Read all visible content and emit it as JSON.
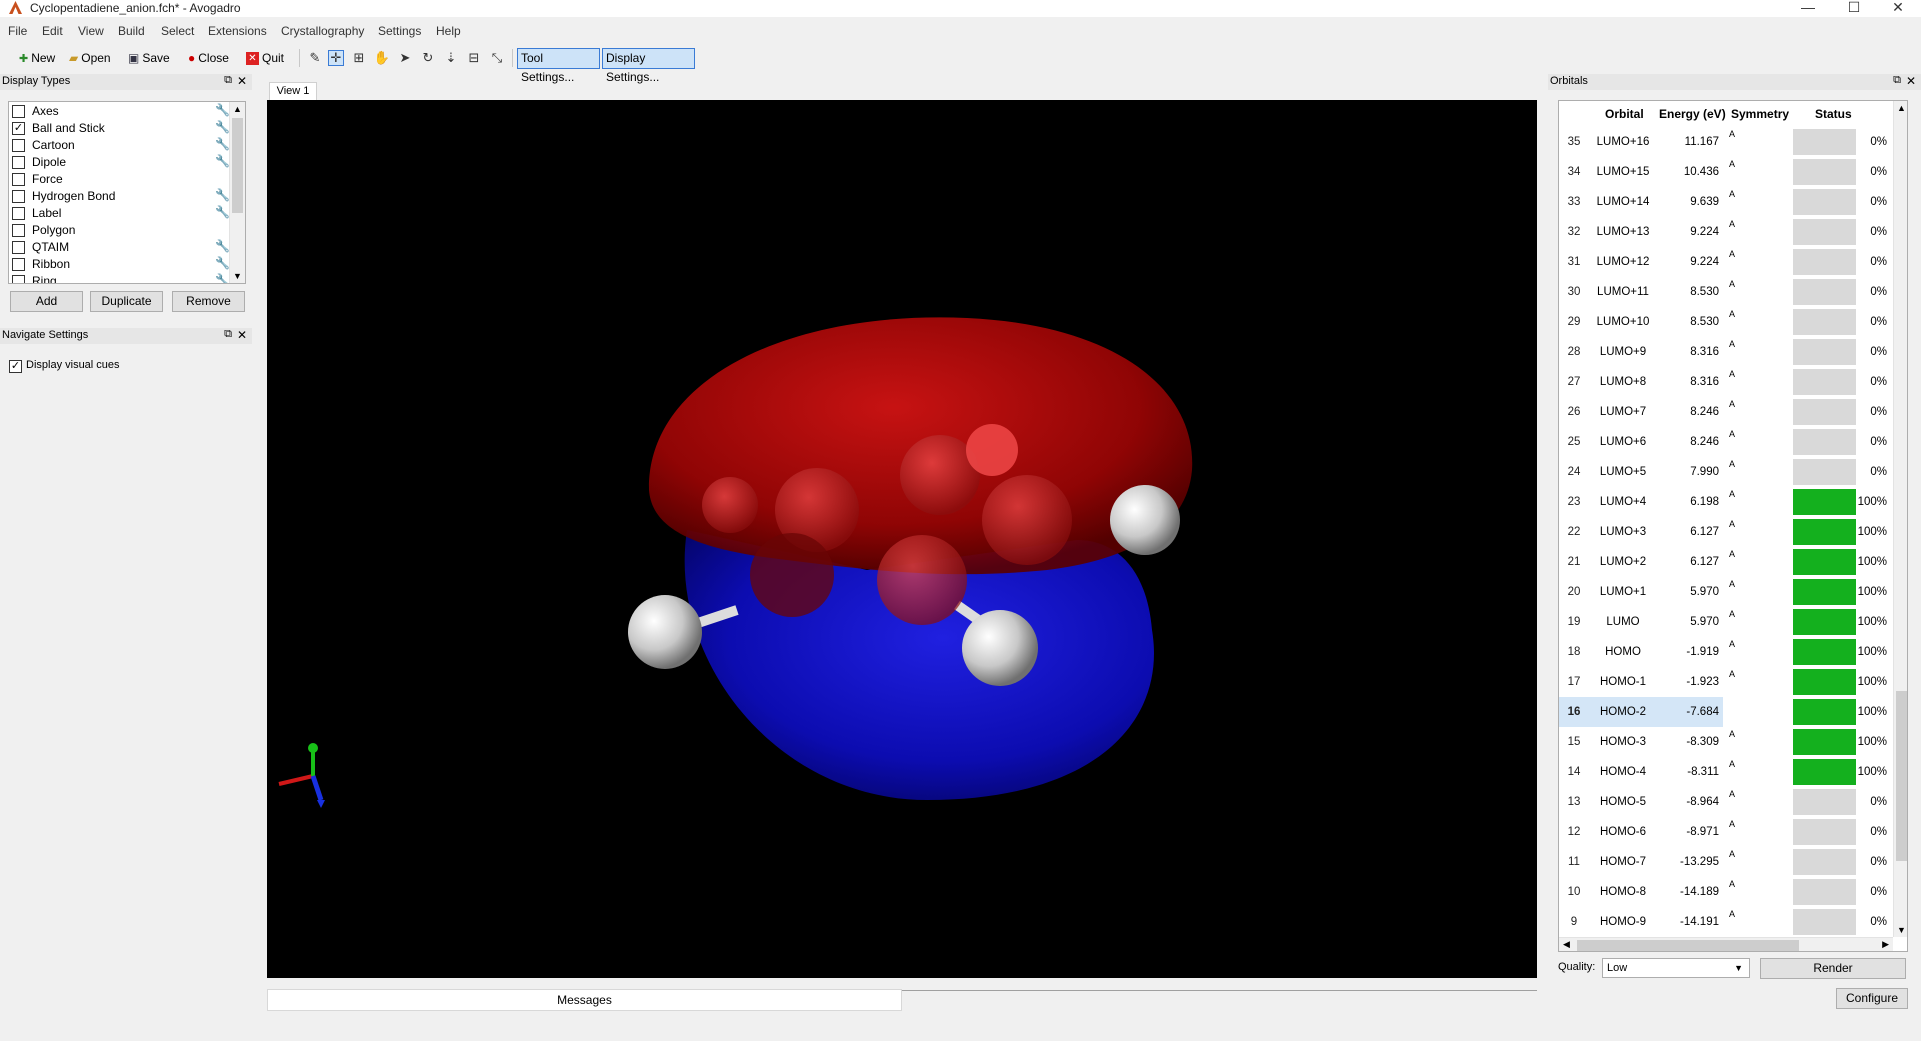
{
  "window": {
    "title": "Cyclopentadiene_anion.fch* - Avogadro",
    "controls": {
      "minimize": "—",
      "maximize": "☐",
      "close": "✕"
    }
  },
  "menubar": [
    "File",
    "Edit",
    "View",
    "Build",
    "Select",
    "Extensions",
    "Crystallography",
    "Settings",
    "Help"
  ],
  "toolbar": {
    "new": "New",
    "open": "Open",
    "save": "Save",
    "close": "Close",
    "quit": "Quit",
    "tool_settings": "Tool Settings...",
    "display_settings": "Display Settings..."
  },
  "display_types": {
    "title": "Display Types",
    "items": [
      {
        "label": "Axes",
        "checked": false,
        "settings": true
      },
      {
        "label": "Ball and Stick",
        "checked": true,
        "settings": true
      },
      {
        "label": "Cartoon",
        "checked": false,
        "settings": true
      },
      {
        "label": "Dipole",
        "checked": false,
        "settings": true
      },
      {
        "label": "Force",
        "checked": false,
        "settings": false
      },
      {
        "label": "Hydrogen Bond",
        "checked": false,
        "settings": true
      },
      {
        "label": "Label",
        "checked": false,
        "settings": true
      },
      {
        "label": "Polygon",
        "checked": false,
        "settings": false
      },
      {
        "label": "QTAIM",
        "checked": false,
        "settings": true
      },
      {
        "label": "Ribbon",
        "checked": false,
        "settings": true
      },
      {
        "label": "Ring",
        "checked": false,
        "settings": true
      }
    ],
    "add": "Add",
    "duplicate": "Duplicate",
    "remove": "Remove"
  },
  "navigate": {
    "title": "Navigate Settings",
    "visual_cues_label": "Display visual cues",
    "visual_cues_checked": true
  },
  "view": {
    "tab": "View 1"
  },
  "messages": {
    "tab": "Messages"
  },
  "orbitals": {
    "title": "Orbitals",
    "headers": {
      "orbital": "Orbital",
      "energy": "Energy (eV)",
      "symmetry": "Symmetry",
      "status": "Status"
    },
    "selected_index": "16",
    "rows": [
      {
        "idx": "35",
        "name": "LUMO+16",
        "energy": "11.167",
        "sym": "A",
        "status": 0,
        "pct": "0%"
      },
      {
        "idx": "34",
        "name": "LUMO+15",
        "energy": "10.436",
        "sym": "A",
        "status": 0,
        "pct": "0%"
      },
      {
        "idx": "33",
        "name": "LUMO+14",
        "energy": "9.639",
        "sym": "A",
        "status": 0,
        "pct": "0%"
      },
      {
        "idx": "32",
        "name": "LUMO+13",
        "energy": "9.224",
        "sym": "A",
        "status": 0,
        "pct": "0%"
      },
      {
        "idx": "31",
        "name": "LUMO+12",
        "energy": "9.224",
        "sym": "A",
        "status": 0,
        "pct": "0%"
      },
      {
        "idx": "30",
        "name": "LUMO+11",
        "energy": "8.530",
        "sym": "A",
        "status": 0,
        "pct": "0%"
      },
      {
        "idx": "29",
        "name": "LUMO+10",
        "energy": "8.530",
        "sym": "A",
        "status": 0,
        "pct": "0%"
      },
      {
        "idx": "28",
        "name": "LUMO+9",
        "energy": "8.316",
        "sym": "A",
        "status": 0,
        "pct": "0%"
      },
      {
        "idx": "27",
        "name": "LUMO+8",
        "energy": "8.316",
        "sym": "A",
        "status": 0,
        "pct": "0%"
      },
      {
        "idx": "26",
        "name": "LUMO+7",
        "energy": "8.246",
        "sym": "A",
        "status": 0,
        "pct": "0%"
      },
      {
        "idx": "25",
        "name": "LUMO+6",
        "energy": "8.246",
        "sym": "A",
        "status": 0,
        "pct": "0%"
      },
      {
        "idx": "24",
        "name": "LUMO+5",
        "energy": "7.990",
        "sym": "A",
        "status": 0,
        "pct": "0%"
      },
      {
        "idx": "23",
        "name": "LUMO+4",
        "energy": "6.198",
        "sym": "A",
        "status": 1,
        "pct": "100%"
      },
      {
        "idx": "22",
        "name": "LUMO+3",
        "energy": "6.127",
        "sym": "A",
        "status": 1,
        "pct": "100%"
      },
      {
        "idx": "21",
        "name": "LUMO+2",
        "energy": "6.127",
        "sym": "A",
        "status": 1,
        "pct": "100%"
      },
      {
        "idx": "20",
        "name": "LUMO+1",
        "energy": "5.970",
        "sym": "A",
        "status": 1,
        "pct": "100%"
      },
      {
        "idx": "19",
        "name": "LUMO",
        "energy": "5.970",
        "sym": "A",
        "status": 1,
        "pct": "100%"
      },
      {
        "idx": "18",
        "name": "HOMO",
        "energy": "-1.919",
        "sym": "A",
        "status": 1,
        "pct": "100%"
      },
      {
        "idx": "17",
        "name": "HOMO-1",
        "energy": "-1.923",
        "sym": "A",
        "status": 1,
        "pct": "100%"
      },
      {
        "idx": "16",
        "name": "HOMO-2",
        "energy": "-7.684",
        "sym": "A",
        "status": 1,
        "pct": "100%"
      },
      {
        "idx": "15",
        "name": "HOMO-3",
        "energy": "-8.309",
        "sym": "A",
        "status": 1,
        "pct": "100%"
      },
      {
        "idx": "14",
        "name": "HOMO-4",
        "energy": "-8.311",
        "sym": "A",
        "status": 1,
        "pct": "100%"
      },
      {
        "idx": "13",
        "name": "HOMO-5",
        "energy": "-8.964",
        "sym": "A",
        "status": 0,
        "pct": "0%"
      },
      {
        "idx": "12",
        "name": "HOMO-6",
        "energy": "-8.971",
        "sym": "A",
        "status": 0,
        "pct": "0%"
      },
      {
        "idx": "11",
        "name": "HOMO-7",
        "energy": "-13.295",
        "sym": "A",
        "status": 0,
        "pct": "0%"
      },
      {
        "idx": "10",
        "name": "HOMO-8",
        "energy": "-14.189",
        "sym": "A",
        "status": 0,
        "pct": "0%"
      },
      {
        "idx": "9",
        "name": "HOMO-9",
        "energy": "-14.191",
        "sym": "A",
        "status": 0,
        "pct": "0%"
      }
    ],
    "quality_label": "Quality:",
    "quality_value": "Low",
    "render": "Render",
    "configure": "Configure"
  },
  "colors": {
    "positive_lobe": "#c00000",
    "negative_lobe": "#1010c8",
    "occupied_status": "#14b01e",
    "selection": "#d4e6f7",
    "active_tool": "#cde3f8"
  }
}
